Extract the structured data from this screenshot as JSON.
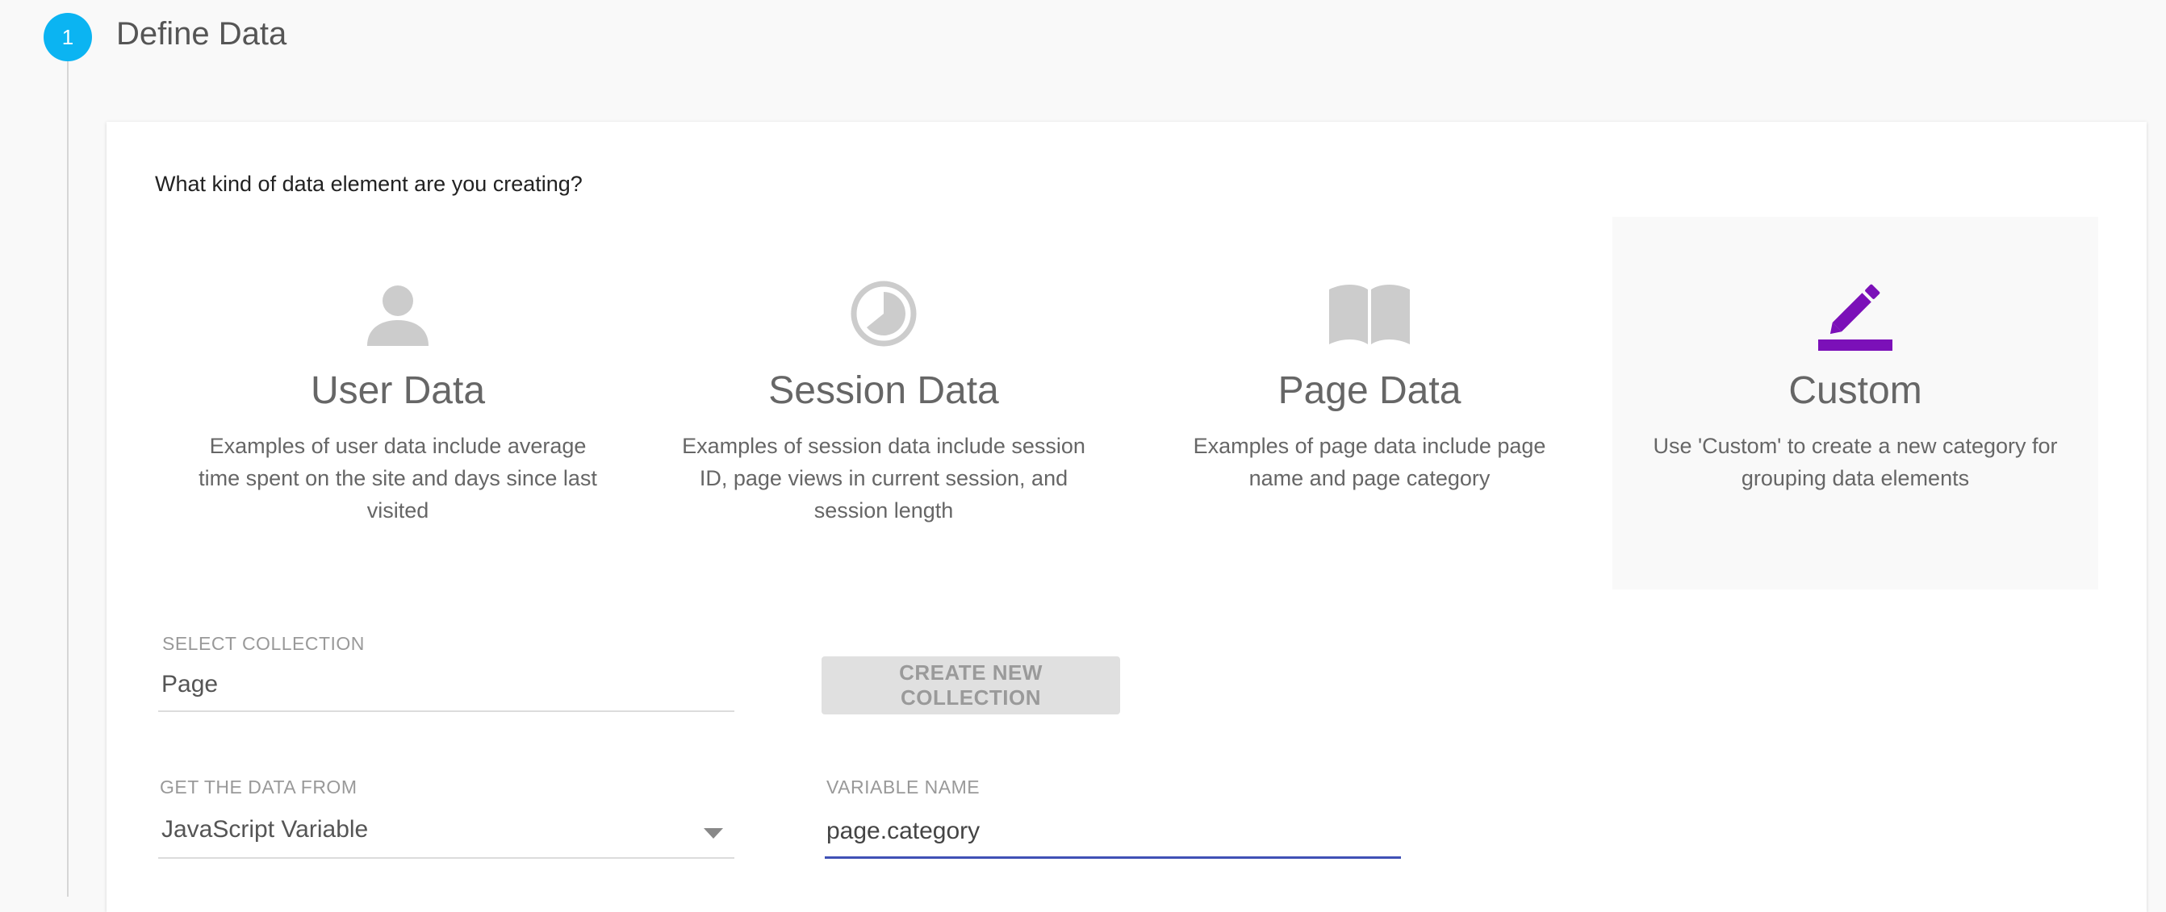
{
  "step": {
    "number": "1",
    "title": "Define Data"
  },
  "form": {
    "question": "What kind of data element are you creating?",
    "tiles": [
      {
        "title": "User Data",
        "description": "Examples of user data include average time spent on the site and days since last visited",
        "icon": "person-icon",
        "selected": false
      },
      {
        "title": "Session Data",
        "description": "Examples of session data include session ID, page views in current session, and session length",
        "icon": "pie-clock-icon",
        "selected": false
      },
      {
        "title": "Page Data",
        "description": "Examples of page data include page name and page category",
        "icon": "open-book-icon",
        "selected": false
      },
      {
        "title": "Custom",
        "description": "Use 'Custom' to create a new category for grouping data elements",
        "icon": "pencil-edit-icon",
        "selected": true
      }
    ],
    "collection": {
      "label": "SELECT COLLECTION",
      "value": "Page"
    },
    "create_button": "CREATE NEW COLLECTION",
    "source": {
      "label": "GET THE DATA FROM",
      "value": "JavaScript Variable"
    },
    "variable": {
      "label": "VARIABLE NAME",
      "value": "page.category"
    }
  },
  "colors": {
    "step_accent": "#0bb4f2",
    "selected_icon": "#7b10b8",
    "inactive_icon": "#cccccc",
    "active_underline": "#3f51b5"
  }
}
